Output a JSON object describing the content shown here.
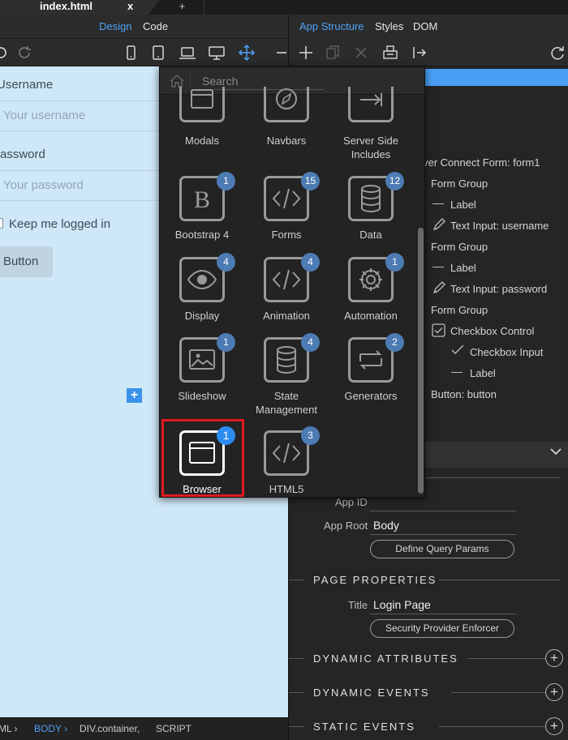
{
  "document_tab": {
    "filename": "index.html",
    "close": "x",
    "new_tab": "+"
  },
  "left_view": {
    "design": "Design",
    "code": "Code"
  },
  "canvas": {
    "username_label": "Username",
    "username_placeholder": "Your username",
    "password_label": "assword",
    "password_placeholder": "Your password",
    "remember_label": "Keep me logged in",
    "button_label": "Button",
    "add_icon": "+"
  },
  "statusbar": {
    "items": [
      "ML ›",
      "BODY ›",
      "DIV.container,",
      "SCRIPT"
    ]
  },
  "right_tabs": {
    "app_structure": "App Structure",
    "styles": "Styles",
    "dom": "DOM"
  },
  "picker": {
    "search_placeholder": "Search",
    "tiles": [
      {
        "label": "Modals",
        "badge": "",
        "icon": "window-icon"
      },
      {
        "label": "Navbars",
        "badge": "",
        "icon": "compass-icon"
      },
      {
        "label": "Server Side Includes",
        "badge": "",
        "icon": "arrow-right-icon"
      },
      {
        "label": "Bootstrap 4",
        "badge": "1",
        "icon": "bootstrap-icon"
      },
      {
        "label": "Forms",
        "badge": "15",
        "icon": "code-icon"
      },
      {
        "label": "Data",
        "badge": "12",
        "icon": "database-icon"
      },
      {
        "label": "Display",
        "badge": "4",
        "icon": "eye-icon"
      },
      {
        "label": "Animation",
        "badge": "4",
        "icon": "code-icon"
      },
      {
        "label": "Automation",
        "badge": "1",
        "icon": "gear-icon"
      },
      {
        "label": "Slideshow",
        "badge": "1",
        "icon": "image-icon"
      },
      {
        "label": "State Management",
        "badge": "4",
        "icon": "database-icon"
      },
      {
        "label": "Generators",
        "badge": "2",
        "icon": "loop-icon"
      },
      {
        "label": "Browser",
        "badge": "1",
        "icon": "window-icon",
        "selected": true
      },
      {
        "label": "HTML5",
        "badge": "3",
        "icon": "code-icon"
      }
    ]
  },
  "tree": {
    "nodes": [
      "ver Connect Form: form1",
      "Form Group",
      "Label",
      "Text Input: username",
      "Form Group",
      "Label",
      "Text Input: password",
      "Form Group",
      "Checkbox Control",
      "Checkbox Input",
      "Label",
      "Button: button"
    ]
  },
  "properties": {
    "app_id_label": "App ID",
    "app_root_label": "App Root",
    "app_root_value": "Body",
    "define_query_btn": "Define Query Params",
    "page_properties": "PAGE PROPERTIES",
    "title_label": "Title",
    "title_value": "Login Page",
    "security_btn": "Security Provider Enforcer",
    "dynamic_attributes": "DYNAMIC ATTRIBUTES",
    "dynamic_events": "DYNAMIC EVENTS",
    "static_events": "STATIC EVENTS",
    "plus": "+"
  },
  "colors": {
    "accent": "#4fa3f7",
    "highlight": "#e01a22",
    "badge": "#4d7bb3",
    "canvas_bg": "#cfe8f8"
  }
}
